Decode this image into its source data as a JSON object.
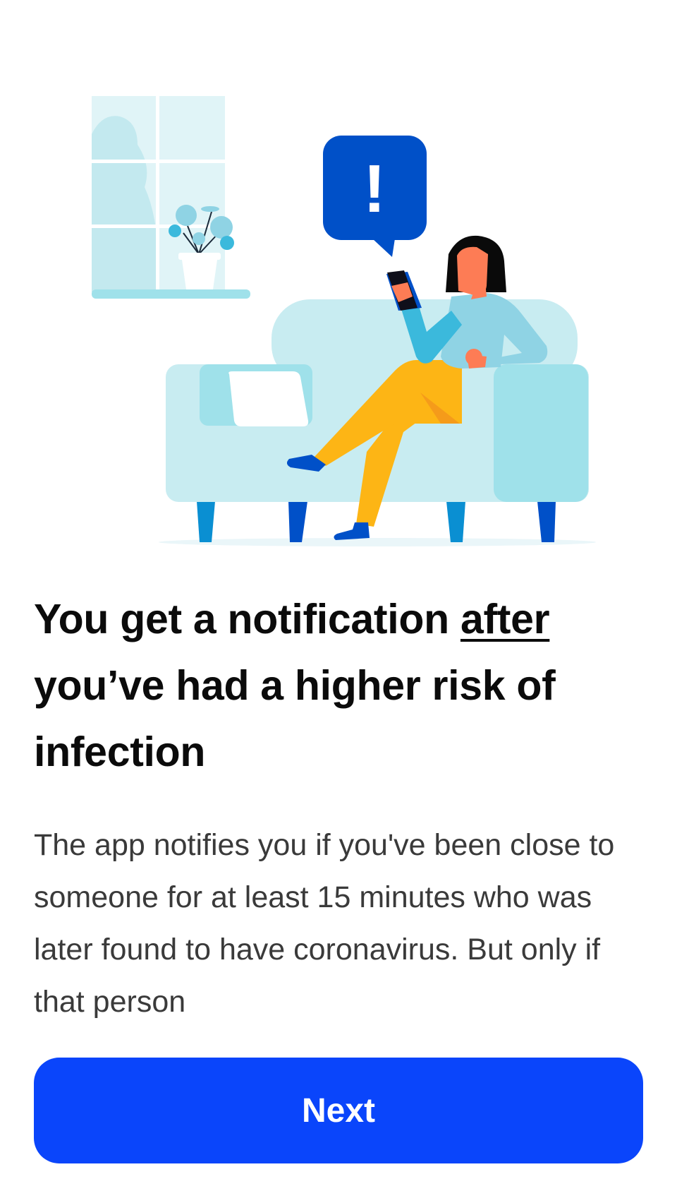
{
  "illustration": {
    "alert_symbol": "!",
    "icon": "woman-on-sofa-reading-phone-notification-illustration"
  },
  "headline": {
    "part1": "You get a notification ",
    "emphasis": "after",
    "part2": " you’ve had a higher risk of infection"
  },
  "body": {
    "text": "The app notifies you if you've been close to someone for at least 15 minutes who was later found to have coronavirus. But only if that person"
  },
  "actions": {
    "next_label": "Next"
  },
  "colors": {
    "primary_button": "#0a45fb",
    "alert_bubble": "#0050c8",
    "sofa": "#c8ecf1",
    "pants": "#fdb515"
  }
}
